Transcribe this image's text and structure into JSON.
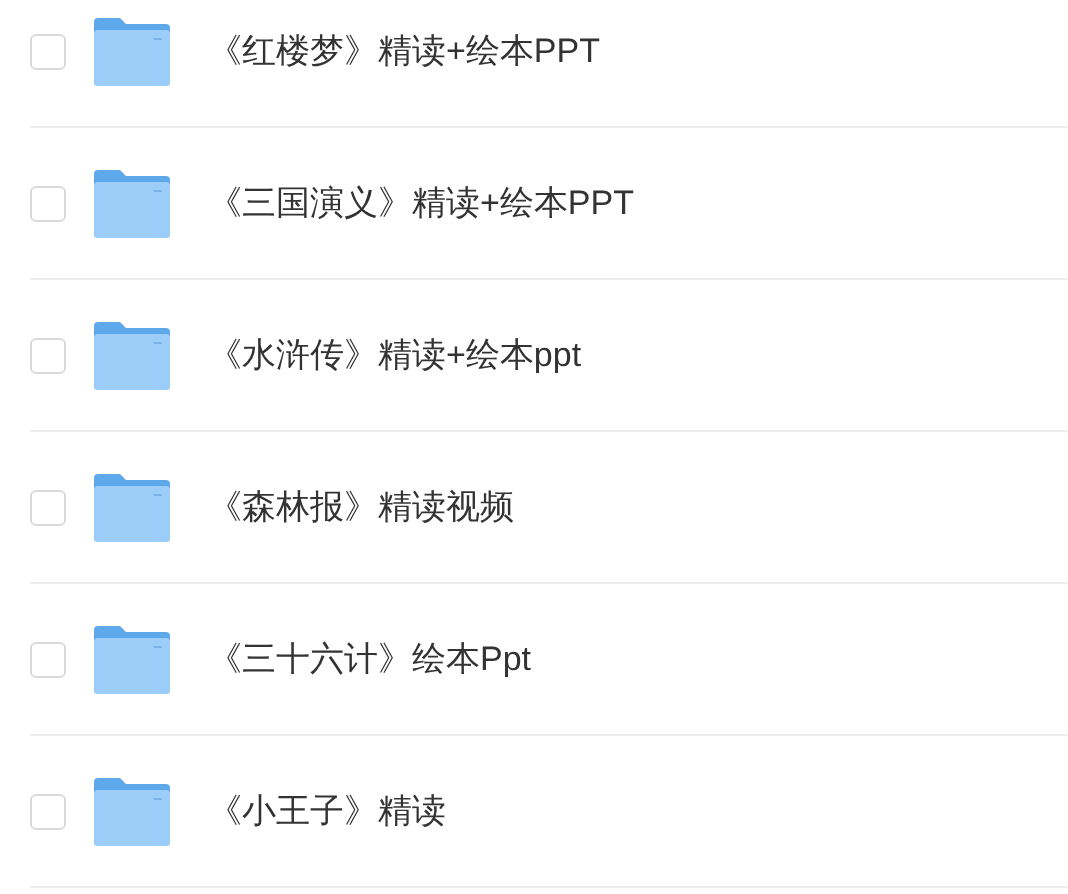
{
  "files": [
    {
      "name": "《红楼梦》精读+绘本PPT",
      "checked": false
    },
    {
      "name": "《三国演义》精读+绘本PPT",
      "checked": false
    },
    {
      "name": "《水浒传》精读+绘本ppt",
      "checked": false
    },
    {
      "name": "《森林报》精读视频",
      "checked": false
    },
    {
      "name": "《三十六计》绘本Ppt",
      "checked": false
    },
    {
      "name": "《小王子》精读",
      "checked": false
    }
  ]
}
